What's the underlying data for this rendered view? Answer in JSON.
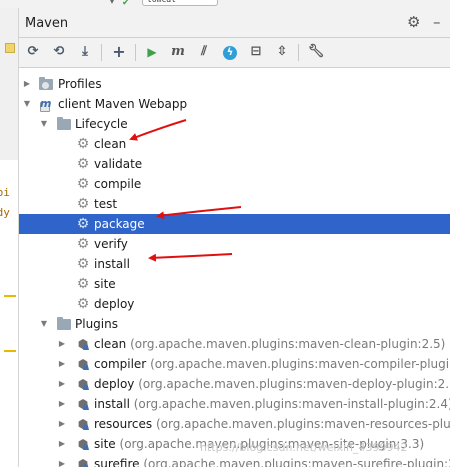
{
  "top_bar": {
    "run_config_snippet": "tomcat"
  },
  "editor": {
    "code_fragments": [
      "ppi",
      "ody"
    ]
  },
  "panel": {
    "title": "Maven",
    "header_icons": [
      "gear-icon",
      "minimize-icon"
    ],
    "toolbar_icons": [
      "reload-icon",
      "generate-sources-icon",
      "download-icon",
      "add-icon",
      "run-icon",
      "execute-goal-icon",
      "toggle-offline-icon",
      "skip-tests-icon",
      "show-dependencies-icon",
      "collapse-all-icon",
      "settings-wrench-icon"
    ]
  },
  "tree": {
    "profiles_label": "Profiles",
    "project_label": "client Maven Webapp",
    "lifecycle_label": "Lifecycle",
    "lifecycle_items": [
      "clean",
      "validate",
      "compile",
      "test",
      "package",
      "verify",
      "install",
      "site",
      "deploy"
    ],
    "selected_item": "package",
    "plugins_label": "Plugins",
    "plugins": [
      {
        "name": "clean",
        "coords": "(org.apache.maven.plugins:maven-clean-plugin:2.5)"
      },
      {
        "name": "compiler",
        "coords": "(org.apache.maven.plugins:maven-compiler-plugin:3"
      },
      {
        "name": "deploy",
        "coords": "(org.apache.maven.plugins:maven-deploy-plugin:2.7)"
      },
      {
        "name": "install",
        "coords": "(org.apache.maven.plugins:maven-install-plugin:2.4)"
      },
      {
        "name": "resources",
        "coords": "(org.apache.maven.plugins:maven-resources-plugi"
      },
      {
        "name": "site",
        "coords": "(org.apache.maven.plugins:maven-site-plugin:3.3)"
      },
      {
        "name": "surefire",
        "coords": "(org.apache.maven.plugins:maven-surefire-plugin:2.1"
      }
    ]
  },
  "annotations": {
    "arrow_color": "#e01010",
    "arrow_targets": [
      "clean",
      "package",
      "install"
    ]
  },
  "watermark": "https://blog.csdn.net/weixin_4399942",
  "colors": {
    "selection": "#2f65ca",
    "run_green": "#3fa14a",
    "maven_blue": "#3d6fb3"
  }
}
